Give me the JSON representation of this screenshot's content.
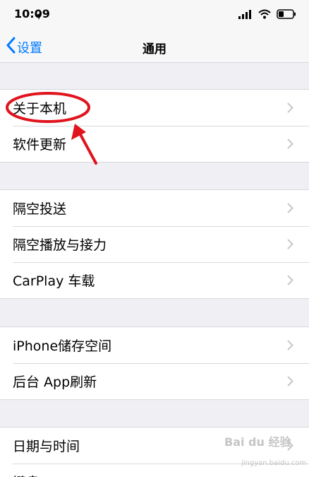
{
  "status_bar": {
    "time": "10:09"
  },
  "nav": {
    "back_label": "设置",
    "title": "通用"
  },
  "groups": [
    {
      "items": [
        {
          "label": "关于本机"
        },
        {
          "label": "软件更新"
        }
      ]
    },
    {
      "items": [
        {
          "label": "隔空投送"
        },
        {
          "label": "隔空播放与接力"
        },
        {
          "label": "CarPlay 车载"
        }
      ]
    },
    {
      "items": [
        {
          "label": "iPhone储存空间"
        },
        {
          "label": "后台 App刷新"
        }
      ]
    },
    {
      "items": [
        {
          "label": "日期与时间"
        },
        {
          "label": "键盘"
        }
      ]
    }
  ],
  "annotation": {
    "color": "#e0141e"
  },
  "watermark": {
    "text": "Bai du 经验",
    "url": "jingyan.baidu.com"
  }
}
